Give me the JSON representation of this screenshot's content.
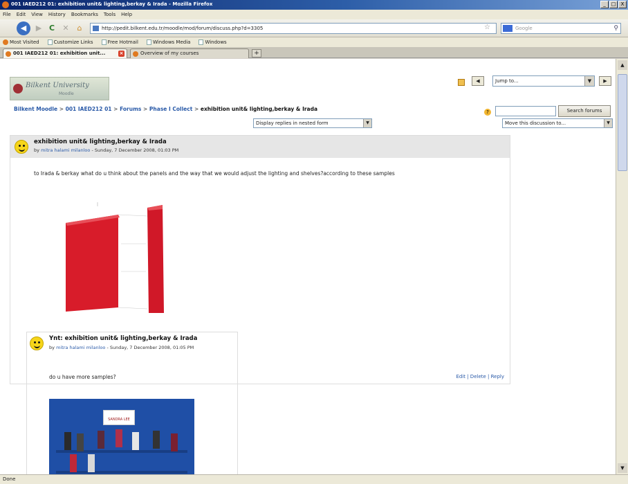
{
  "window": {
    "title": "001 IAED212 01: exhibition unit& lighting,berkay & Irada - Mozilla Firefox",
    "buttons": [
      "_",
      "□",
      "X"
    ]
  },
  "menu": [
    "File",
    "Edit",
    "View",
    "History",
    "Bookmarks",
    "Tools",
    "Help"
  ],
  "nav": {
    "url": "http://pedit.bilkent.edu.tr/moodle/mod/forum/discuss.php?d=3305",
    "search_placeholder": "Google"
  },
  "bookmarks": [
    "Most Visited",
    "Customize Links",
    "Free Hotmail",
    "Windows Media",
    "Windows"
  ],
  "tabs": [
    {
      "label": "001 IAED212 01: exhibition unit..."
    },
    {
      "label": "Overview of my courses"
    }
  ],
  "header": {
    "logo_text": "Bilkent University",
    "logo_sub": "Moodle",
    "jump_label": "Jump to..."
  },
  "breadcrumb": {
    "items": [
      "Bilkent Moodle",
      "001 IAED212 01",
      "Forums",
      "Phase I Collect"
    ],
    "separator": ">",
    "current": "exhibition unit& lighting,berkay & Irada"
  },
  "search": {
    "button_label": "Search forums"
  },
  "controls": {
    "display_mode": "Display replies in nested form",
    "move_to": "Move this discussion to..."
  },
  "posts": [
    {
      "subject": "exhibition unit& lighting,berkay & Irada",
      "by": "by",
      "author": "mitra halami milanloo",
      "date": " - Sunday, 7 December 2008, 01:03 PM",
      "body": "to Irada & berkay what do u think about the panels and the way that we would adjust the lighting and shelves?according to these samples",
      "actions": "Edit | Delete | Reply"
    },
    {
      "subject": "Ynt: exhibition unit& lighting,berkay & Irada",
      "by": "by",
      "author": "mitra halami milanloo",
      "date": " - Sunday, 7 December 2008, 01:05 PM",
      "body": "do u have more samples?",
      "sign": "SANDRA LEE"
    }
  ],
  "status": "Done"
}
